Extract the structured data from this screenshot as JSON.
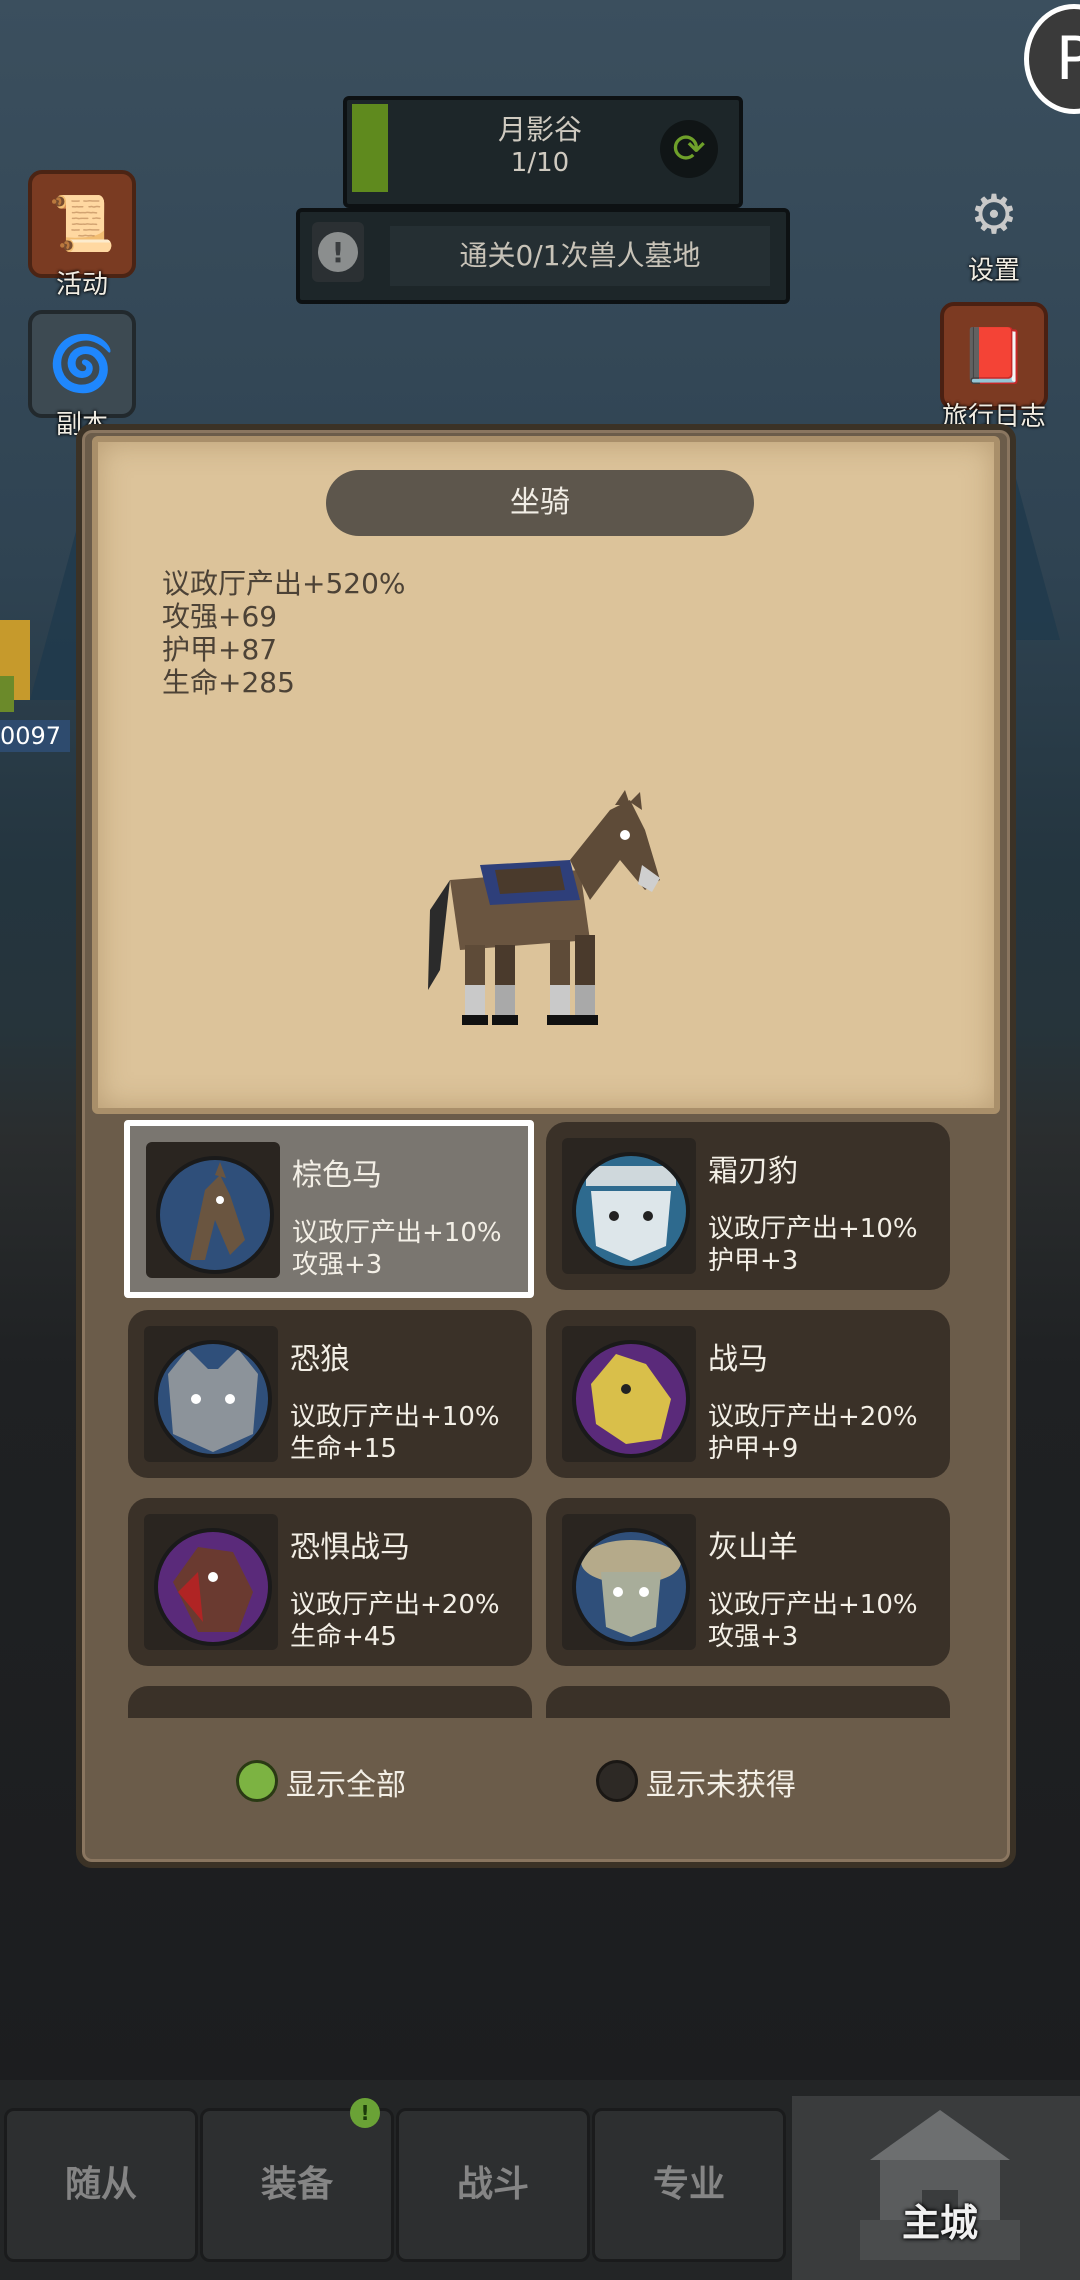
{
  "stage": {
    "name": "月影谷",
    "progress": "1/10",
    "progress_fraction": 0.1
  },
  "quest": {
    "text": "通关0/1次兽人墓地"
  },
  "side_left": [
    {
      "label": "活动",
      "icon": "activity-book-icon"
    },
    {
      "label": "副本",
      "icon": "dungeon-portal-icon"
    }
  ],
  "side_right": [
    {
      "label": "设置",
      "icon": "gear-icon"
    },
    {
      "label": "旅行日志",
      "icon": "journal-icon"
    }
  ],
  "left_fragment_number": "0097",
  "modal": {
    "title": "坐骑",
    "stats": [
      "议政厅产出+520%",
      "攻强+69",
      "护甲+87",
      "生命+285"
    ]
  },
  "mounts": [
    {
      "name": "棕色马",
      "line1": "议政厅产出+10%",
      "line2": "攻强+3",
      "selected": true,
      "portrait_color": "#2f4f7a",
      "icon": "brown-horse-icon"
    },
    {
      "name": "霜刃豹",
      "line1": "议政厅产出+10%",
      "line2": "护甲+3",
      "selected": false,
      "portrait_color": "#2e6a8e",
      "icon": "frost-leopard-icon"
    },
    {
      "name": "恐狼",
      "line1": "议政厅产出+10%",
      "line2": "生命+15",
      "selected": false,
      "portrait_color": "#2f4f7a",
      "icon": "dire-wolf-icon"
    },
    {
      "name": "战马",
      "line1": "议政厅产出+20%",
      "line2": "护甲+9",
      "selected": false,
      "portrait_color": "#5a2a7a",
      "icon": "warhorse-icon"
    },
    {
      "name": "恐惧战马",
      "line1": "议政厅产出+20%",
      "line2": "生命+45",
      "selected": false,
      "portrait_color": "#5a2a7a",
      "icon": "dread-steed-icon"
    },
    {
      "name": "灰山羊",
      "line1": "议政厅产出+10%",
      "line2": "攻强+3",
      "selected": false,
      "portrait_color": "#2f4f7a",
      "icon": "gray-ram-icon"
    }
  ],
  "filters": {
    "show_all": "显示全部",
    "show_unobtained": "显示未获得",
    "active": "show_all"
  },
  "tabs": [
    "随从",
    "装备",
    "战斗",
    "专业"
  ],
  "main_tab": "主城",
  "badge": "!",
  "colors": {
    "accent_green": "#6aa236",
    "parchment": "#dcc39a",
    "card": "#3a3128"
  }
}
